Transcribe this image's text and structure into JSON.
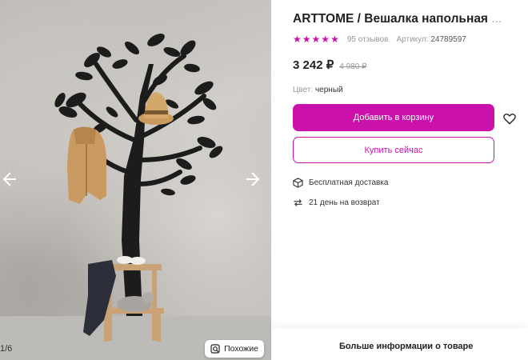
{
  "product": {
    "title": "ARTTOME / Вешалка напольная",
    "title_ellipsis": "...",
    "rating_stars": 5,
    "reviews": "95 отзывов",
    "article_label": "Артикул:",
    "article_value": "24789597",
    "price": "3 242 ₽",
    "old_price": "4 980 ₽",
    "color_label": "Цвет:",
    "color_value": "черный"
  },
  "actions": {
    "add_to_cart": "Добавить в корзину",
    "buy_now": "Купить сейчас"
  },
  "features": [
    {
      "icon": "box-icon",
      "text": "Бесплатная доставка"
    },
    {
      "icon": "return-arrows-icon",
      "text": "21 день на возврат"
    }
  ],
  "gallery": {
    "counter": "1/6",
    "similar_label": "Похожие"
  },
  "more_info": "Больше информации о товаре",
  "colors": {
    "accent": "#cb11ab",
    "text": "#222222",
    "muted": "#999999"
  }
}
